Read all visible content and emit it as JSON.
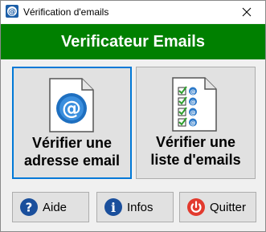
{
  "window": {
    "title": "Vérification d'emails",
    "close_symbol": "✕",
    "icon": "app-at-icon"
  },
  "header": {
    "title": "Verificateur Emails",
    "background": "#008000"
  },
  "actions": {
    "verify_one": {
      "line1": "Vérifier une",
      "line2": "adresse email",
      "icon": "at-document-icon"
    },
    "verify_list": {
      "line1": "Vérifier une",
      "line2": "liste d'emails",
      "icon": "checklist-document-icon"
    }
  },
  "footer": {
    "help": {
      "label": "Aide",
      "icon": "question-icon",
      "color": "#1a4f9c"
    },
    "info": {
      "label": "Infos",
      "icon": "info-icon",
      "color": "#1a4f9c"
    },
    "quit": {
      "label": "Quitter",
      "icon": "power-icon",
      "color": "#e23a2e"
    }
  },
  "colors": {
    "focus": "#0078d7",
    "check": "#2e9e2e"
  }
}
